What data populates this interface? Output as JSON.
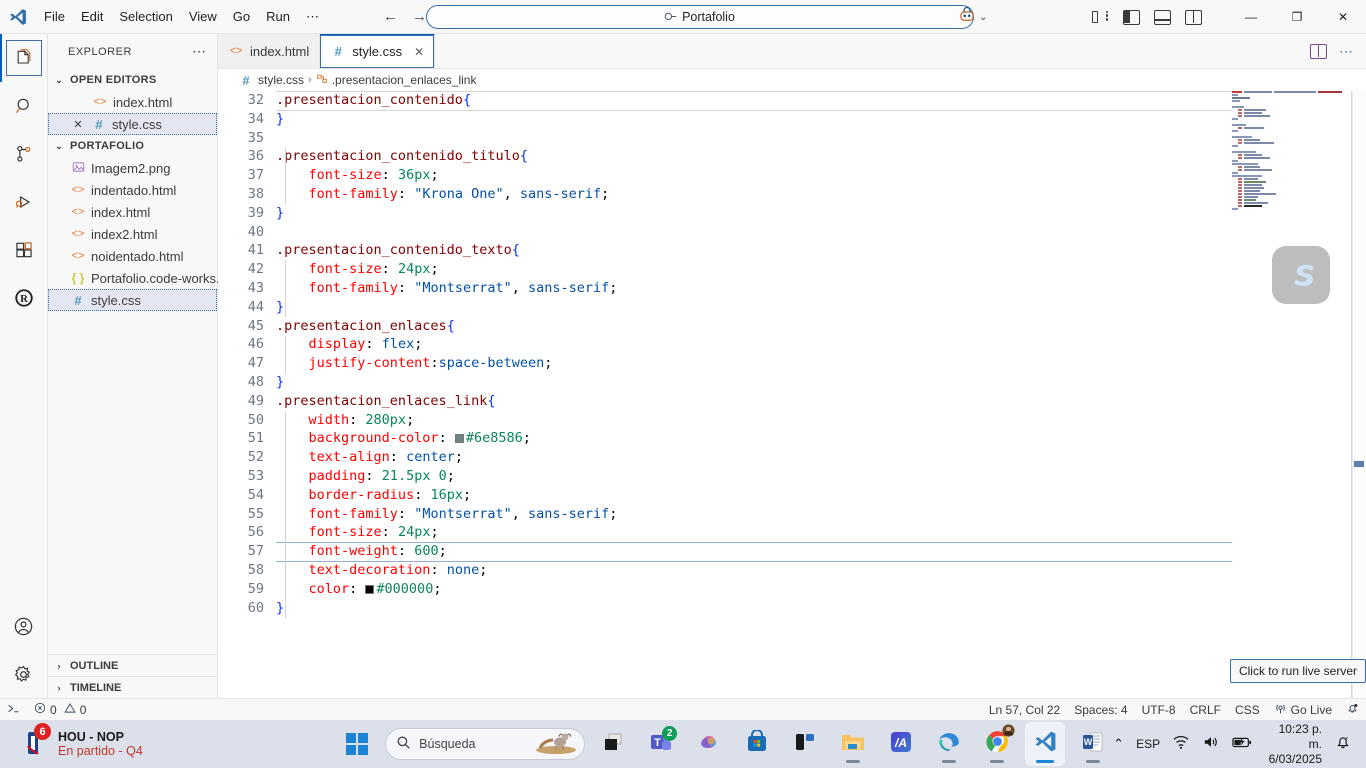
{
  "titlebar": {
    "logo_icon": "vscode-logo-icon",
    "menu": [
      {
        "label": "File"
      },
      {
        "label": "Edit"
      },
      {
        "label": "Selection"
      },
      {
        "label": "View"
      },
      {
        "label": "Go"
      },
      {
        "label": "Run"
      },
      {
        "label": "⋯"
      }
    ],
    "nav_back": "←",
    "nav_forward": "→",
    "command_center": {
      "value": "Portafolio",
      "search_icon": "search-icon"
    },
    "account_icon": "accounts-icon",
    "account_chevron": "⌄",
    "layout_icons": [
      "customize-layout-icon",
      "toggle-primary-sidebar-icon",
      "toggle-panel-icon",
      "toggle-secondary-sidebar-icon"
    ],
    "window_minimize": "—",
    "window_restore": "❐",
    "window_close": "✕"
  },
  "activitybar": {
    "items": [
      {
        "name": "explorer",
        "icon": "files-icon",
        "active": true
      },
      {
        "name": "search",
        "icon": "search-icon",
        "active": false
      },
      {
        "name": "source-control",
        "icon": "source-control-icon",
        "active": false
      },
      {
        "name": "run-and-debug",
        "icon": "run-debug-icon",
        "active": false
      },
      {
        "name": "extensions",
        "icon": "extensions-icon",
        "active": false
      },
      {
        "name": "r-extension",
        "icon": "r-language-icon",
        "active": false
      }
    ],
    "bottom": [
      {
        "name": "accounts",
        "icon": "account-circle-icon"
      },
      {
        "name": "manage",
        "icon": "gear-icon"
      }
    ]
  },
  "sidebar": {
    "title": "EXPLORER",
    "more_actions": "⋯",
    "open_editors": {
      "label": "OPEN EDITORS",
      "expanded": true,
      "items": [
        {
          "label": "index.html",
          "icon": "html-file-icon",
          "selected": false,
          "has_close": false
        },
        {
          "label": "style.css",
          "icon": "css-file-icon",
          "selected": true,
          "has_close": true,
          "close": "✕"
        }
      ]
    },
    "folder": {
      "label": "PORTAFOLIO",
      "expanded": true,
      "items": [
        {
          "label": "Imagem2.png",
          "icon": "image-file-icon",
          "selected": false
        },
        {
          "label": "indentado.html",
          "icon": "html-file-icon",
          "selected": false
        },
        {
          "label": "index.html",
          "icon": "html-file-icon",
          "selected": false
        },
        {
          "label": "index2.html",
          "icon": "html-file-icon",
          "selected": false
        },
        {
          "label": "noidentado.html",
          "icon": "html-file-icon",
          "selected": false
        },
        {
          "label": "Portafolio.code-works...",
          "icon": "json-file-icon",
          "selected": false
        },
        {
          "label": "style.css",
          "icon": "css-file-icon",
          "selected": true
        }
      ]
    },
    "panels": [
      {
        "label": "OUTLINE",
        "expanded": false
      },
      {
        "label": "TIMELINE",
        "expanded": false
      }
    ]
  },
  "editor": {
    "tabs": [
      {
        "label": "index.html",
        "icon": "html-file-icon",
        "active": false,
        "dirty": false
      },
      {
        "label": "style.css",
        "icon": "css-file-icon",
        "active": true,
        "close": "✕"
      }
    ],
    "tab_actions": [
      "split-editor-icon",
      "more-actions-icon"
    ],
    "breadcrumbs": [
      {
        "label": "style.css",
        "icon": "css-file-icon"
      },
      {
        "label": ".presentacion_enlaces_link",
        "icon": "css-symbol-icon"
      }
    ],
    "language": "css",
    "current_line": 57,
    "lines": [
      {
        "num": "32",
        "text": ".presentacion_contenido{"
      },
      {
        "num": "34",
        "text": "}"
      },
      {
        "num": "35",
        "text": ""
      },
      {
        "num": "36",
        "text": ".presentacion_contenido_titulo{"
      },
      {
        "num": "37",
        "text": "    font-size: 36px;"
      },
      {
        "num": "38",
        "text": "    font-family: \"Krona One\", sans-serif;"
      },
      {
        "num": "39",
        "text": "}"
      },
      {
        "num": "40",
        "text": ""
      },
      {
        "num": "41",
        "text": ".presentacion_contenido_texto{"
      },
      {
        "num": "42",
        "text": "    font-size: 24px;"
      },
      {
        "num": "43",
        "text": "    font-family: \"Montserrat\", sans-serif;"
      },
      {
        "num": "44",
        "text": "}"
      },
      {
        "num": "45",
        "text": ".presentacion_enlaces{"
      },
      {
        "num": "46",
        "text": "    display: flex;"
      },
      {
        "num": "47",
        "text": "    justify-content:space-between;"
      },
      {
        "num": "48",
        "text": "}"
      },
      {
        "num": "49",
        "text": ".presentacion_enlaces_link{"
      },
      {
        "num": "50",
        "text": "    width: 280px;"
      },
      {
        "num": "51",
        "text": "    background-color: #6e8586;"
      },
      {
        "num": "52",
        "text": "    text-align: center;"
      },
      {
        "num": "53",
        "text": "    padding: 21.5px 0;"
      },
      {
        "num": "54",
        "text": "    border-radius: 16px;"
      },
      {
        "num": "55",
        "text": "    font-family: \"Montserrat\", sans-serif;"
      },
      {
        "num": "56",
        "text": "    font-size: 24px;"
      },
      {
        "num": "57",
        "text": "    font-weight: 600;"
      },
      {
        "num": "58",
        "text": "    text-decoration: none;"
      },
      {
        "num": "59",
        "text": "    color: #000000;"
      },
      {
        "num": "60",
        "text": "}"
      }
    ],
    "inline_colors": [
      {
        "line": "51",
        "value": "#6e8586"
      },
      {
        "line": "59",
        "value": "#000000"
      }
    ],
    "minimap_visible": true,
    "watermark_icon": "scribble-logo-icon"
  },
  "tooltip": {
    "text": "Click to run live server"
  },
  "statusbar": {
    "left": [
      {
        "name": "remote-indicator",
        "icon": "remote-icon",
        "label": ""
      },
      {
        "name": "problems",
        "icon": "error-warning-icon",
        "label": "0 ⚠ 0",
        "errors": "0",
        "warnings": "0"
      }
    ],
    "right": [
      {
        "name": "editor-position",
        "label": "Ln 57, Col 22"
      },
      {
        "name": "editor-indentation",
        "label": "Spaces: 4"
      },
      {
        "name": "editor-encoding",
        "label": "UTF-8"
      },
      {
        "name": "editor-eol",
        "label": "CRLF"
      },
      {
        "name": "editor-language",
        "label": "CSS"
      },
      {
        "name": "go-live",
        "label": "Go Live",
        "icon": "broadcast-icon"
      },
      {
        "name": "notifications",
        "label": "",
        "icon": "bell-dot-icon"
      }
    ]
  },
  "taskbar": {
    "widget": {
      "badge_count": "6",
      "title": "HOU - NOP",
      "subtitle": "En partido - Q4",
      "icon": "nba-icon"
    },
    "start_icon": "windows-start-icon",
    "search": {
      "placeholder": "Búsqueda",
      "search_icon": "search-icon",
      "illustration_icon": "desert-ram-icon"
    },
    "apps": [
      {
        "name": "task-view",
        "icon": "task-view-icon",
        "running": false,
        "active": false,
        "badge": ""
      },
      {
        "name": "microsoft-teams",
        "icon": "teams-icon",
        "running": false,
        "active": false,
        "badge": "2"
      },
      {
        "name": "copilot",
        "icon": "copilot-icon",
        "running": false,
        "active": false,
        "badge": ""
      },
      {
        "name": "microsoft-store",
        "icon": "store-icon",
        "running": false,
        "active": false,
        "badge": ""
      },
      {
        "name": "widgets",
        "icon": "widgets-icon",
        "running": false,
        "active": false,
        "badge": ""
      },
      {
        "name": "file-explorer",
        "icon": "folder-icon",
        "running": true,
        "active": false,
        "badge": ""
      },
      {
        "name": "mega",
        "icon": "mega-icon",
        "running": false,
        "active": false,
        "badge": ""
      },
      {
        "name": "microsoft-edge",
        "icon": "edge-icon",
        "running": true,
        "active": false,
        "badge": ""
      },
      {
        "name": "google-chrome",
        "icon": "chrome-icon",
        "running": true,
        "active": false,
        "badge": ""
      },
      {
        "name": "visual-studio-code",
        "icon": "vscode-icon",
        "running": true,
        "active": true,
        "badge": ""
      },
      {
        "name": "microsoft-word",
        "icon": "word-icon",
        "running": true,
        "active": false,
        "badge": ""
      }
    ],
    "tray": {
      "overflow_icon": "chevron-up-icon",
      "language": "ESP",
      "wifi_icon": "wifi-icon",
      "volume_icon": "speaker-icon",
      "battery_icon": "battery-icon",
      "time": "10:23 p. m.",
      "date": "6/03/2025",
      "notifications_icon": "do-not-disturb-bell-icon"
    }
  },
  "colors": {
    "accent": "#005fb8",
    "titlebar_bg": "#f8f8f8",
    "editor_bg": "#ffffff",
    "taskbar_bg": "#dbe0ea",
    "selector": "#800000",
    "property": "#ff0000",
    "value": "#0451a5",
    "number": "#098658",
    "string": "#a31515",
    "brace": "#0431fa",
    "css_preview_color": "#6e8586",
    "text_color_value": "#000000",
    "badge_red": "#e02020",
    "subtitle_red": "#c0392b"
  }
}
